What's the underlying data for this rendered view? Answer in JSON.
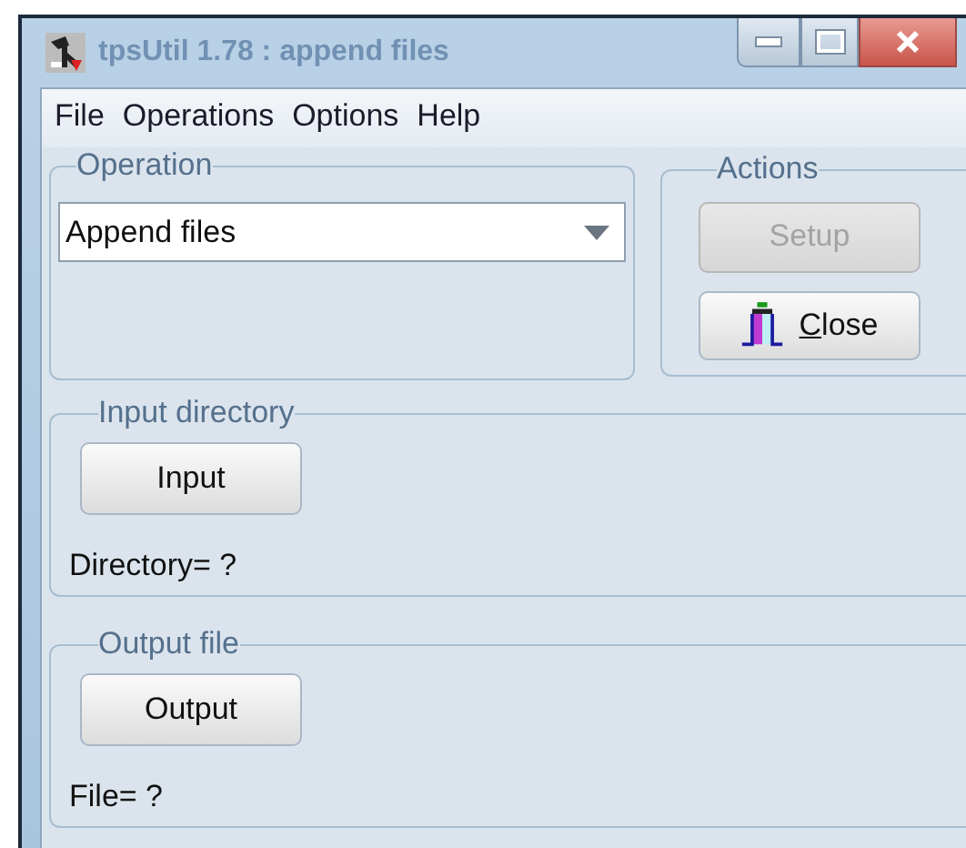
{
  "window": {
    "title": "tpsUtil 1.78 : append files"
  },
  "menu": [
    "File",
    "Operations",
    "Options",
    "Help"
  ],
  "operation": {
    "legend": "Operation",
    "selected_value": "Append files"
  },
  "actions": {
    "legend": "Actions",
    "buttons": [
      {
        "kind": "plain",
        "label": "Setup",
        "disabled": true
      },
      {
        "kind": "icon",
        "mnemonic": "C",
        "label_rest": "lose",
        "disabled": false
      }
    ]
  },
  "input_directory": {
    "legend": "Input directory",
    "button": "Input",
    "status": "Directory= ?"
  },
  "output_file": {
    "legend": "Output file",
    "button": "Output",
    "status": "File= ?"
  }
}
